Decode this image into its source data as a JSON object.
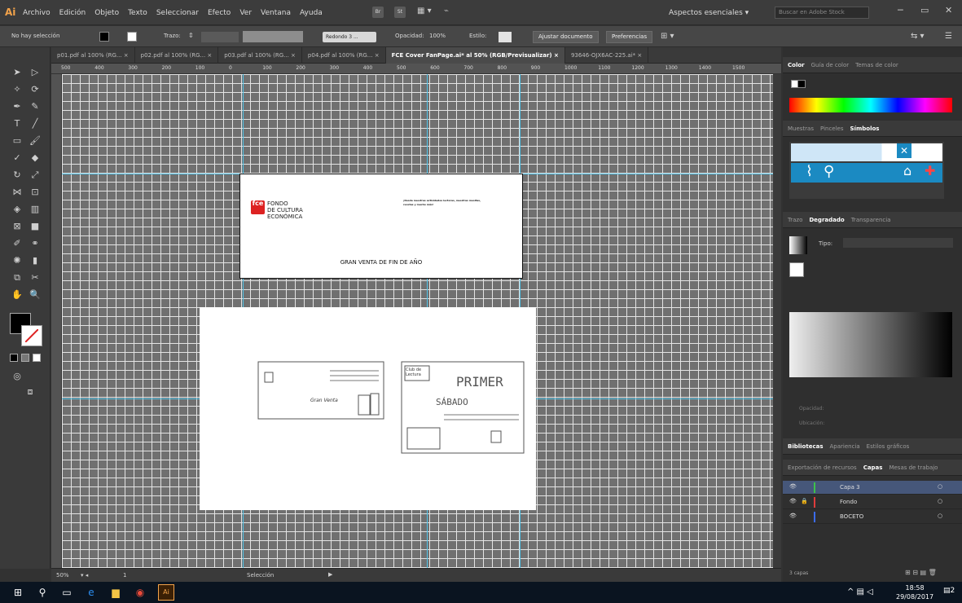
{
  "app": {
    "logo": "Ai",
    "menus": [
      "Archivo",
      "Edición",
      "Objeto",
      "Texto",
      "Seleccionar",
      "Efecto",
      "Ver",
      "Ventana",
      "Ayuda"
    ],
    "bridge": "Br",
    "stock": "St",
    "workspace": "Aspectos esenciales",
    "search_placeholder": "Buscar en Adobe Stock"
  },
  "control": {
    "selection": "No hay selección",
    "stroke_label": "Trazo:",
    "brush": "Redondo 3 ...",
    "opacity_label": "Opacidad:",
    "opacity_value": "100%",
    "style_label": "Estilo:",
    "doc_setup": "Ajustar documento",
    "prefs": "Preferencias"
  },
  "tabs": [
    "p01.pdf al 100% (RG... ×",
    "p02.pdf al 100% (RG... ×",
    "p03.pdf al 100% (RG... ×",
    "p04.pdf al 100% (RG... ×",
    "FCE Cover FanPage.ai* al 50% (RGB/Previsualizar) ×",
    "93646-OJX6AC-225.ai* ×"
  ],
  "ruler_ticks": [
    "500",
    "400",
    "300",
    "200",
    "100",
    "0",
    "100",
    "200",
    "300",
    "400",
    "500",
    "600",
    "700",
    "800",
    "900",
    "1000",
    "1100",
    "1200",
    "1300",
    "1400",
    "1500"
  ],
  "artboard1": {
    "logo_mark": "fce",
    "logo_line1": "FONDO",
    "logo_line2": "DE CULTURA",
    "logo_line3": "ECONÓMICA",
    "small_text": "¡Desde nuestras actividades lectoras, nuestras mesitas, recetas y mucho más!",
    "headline": "GRAN VENTA DE FIN DE AÑO"
  },
  "sketch": {
    "left_label": "Gran Venta",
    "club": "Club de Lectura",
    "primer": "PRIMER",
    "sabado": "SÁBADO"
  },
  "status": {
    "zoom": "50%",
    "page": "1",
    "tool": "Selección"
  },
  "panels": {
    "color_tabs": [
      "Color",
      "Guía de color",
      "Temas de color"
    ],
    "symbol_tabs": [
      "Muestras",
      "Pinceles",
      "Símbolos"
    ],
    "gradient_tabs": [
      "Trazo",
      "Degradado",
      "Transparencia"
    ],
    "gradient_type_label": "Tipo:",
    "opacity_label": "Opacidad:",
    "location_label": "Ubicación:",
    "lib_tabs": [
      "Bibliotecas",
      "Apariencia",
      "Estilos gráficos"
    ],
    "layer_tabs": [
      "Exportación de recursos",
      "Capas",
      "Mesas de trabajo"
    ],
    "layers": [
      {
        "name": "Capa 3",
        "color": "#3ec24a",
        "selected": true
      },
      {
        "name": "Fondo",
        "color": "#e03c3c",
        "selected": false
      },
      {
        "name": "BOCETO",
        "color": "#3b6cf0",
        "selected": false
      }
    ],
    "layer_count": "3 capas"
  },
  "taskbar": {
    "time": "18:58",
    "date": "29/08/2017",
    "notif": "2"
  }
}
